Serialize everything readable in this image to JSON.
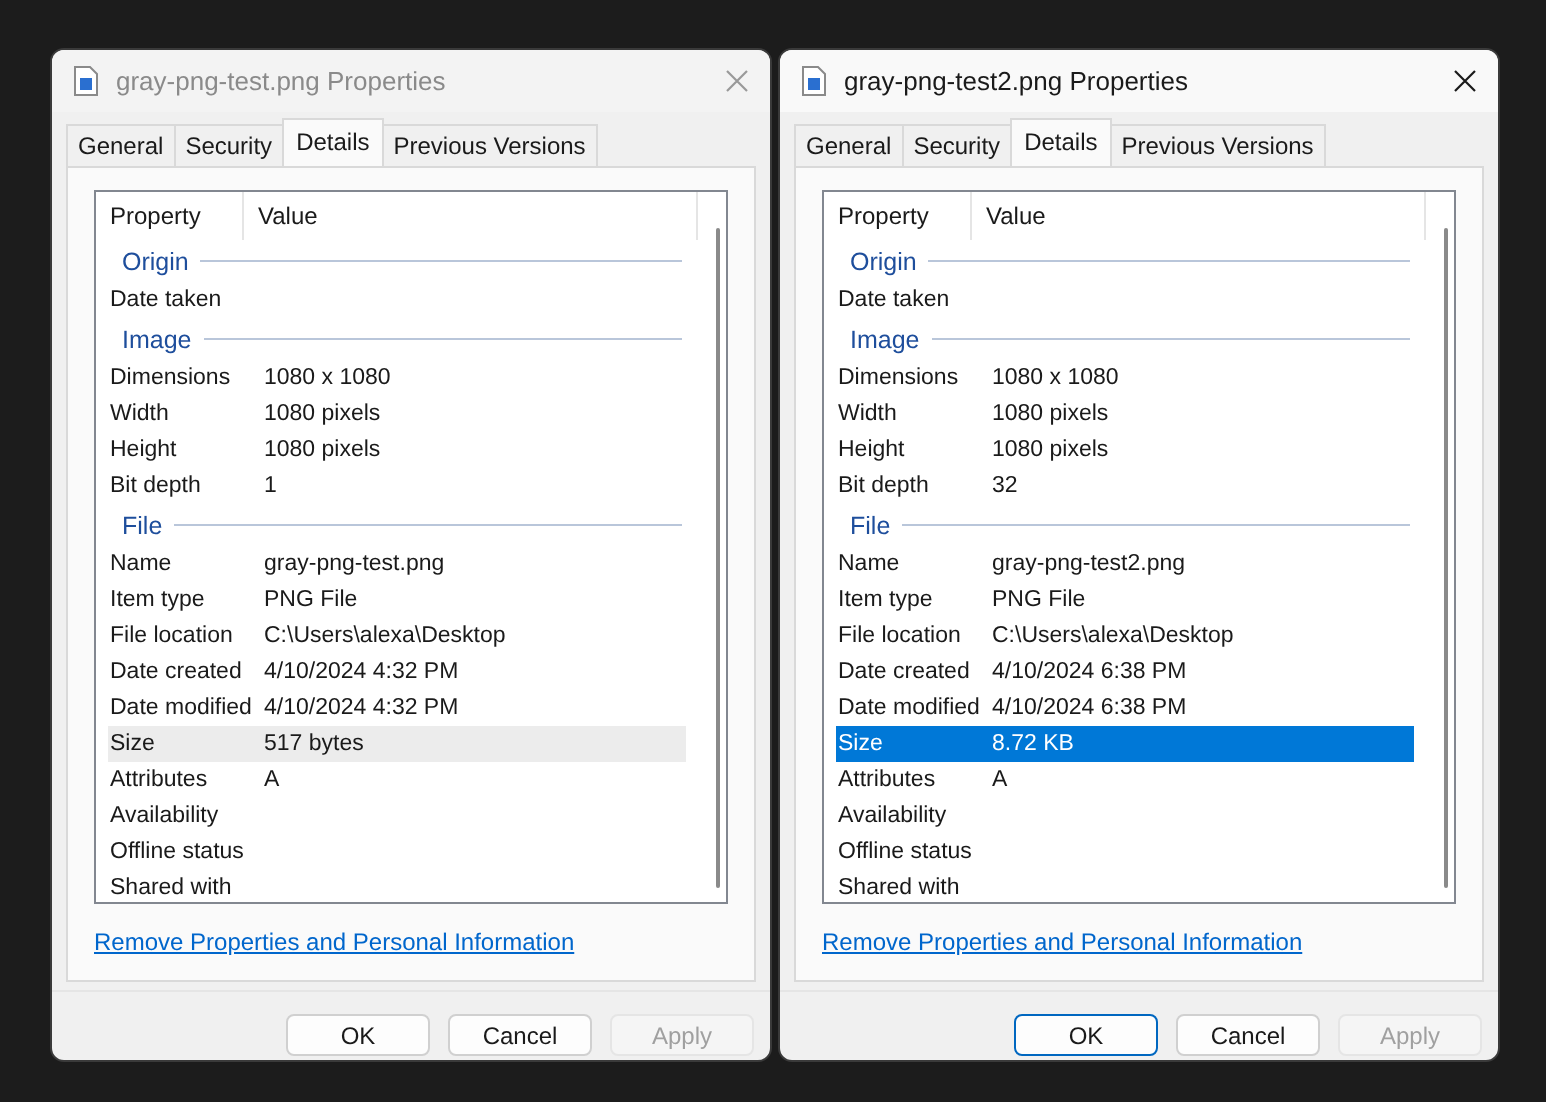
{
  "windows": [
    {
      "title": "gray-png-test.png Properties",
      "active": false,
      "tabs": [
        {
          "label": "General",
          "selected": false
        },
        {
          "label": "Security",
          "selected": false
        },
        {
          "label": "Details",
          "selected": true
        },
        {
          "label": "Previous Versions",
          "selected": false
        }
      ],
      "columns": [
        "Property",
        "Value"
      ],
      "rows": [
        {
          "kind": "section",
          "label": "Origin"
        },
        {
          "kind": "property",
          "name": "Date taken",
          "selected": false
        },
        {
          "kind": "section",
          "label": "Image"
        },
        {
          "kind": "property",
          "name": "Dimensions",
          "value": "1080 x 1080",
          "selected": false
        },
        {
          "kind": "property",
          "name": "Width",
          "value": "1080 pixels",
          "selected": false
        },
        {
          "kind": "property",
          "name": "Height",
          "value": "1080 pixels",
          "selected": false
        },
        {
          "kind": "property",
          "name": "Bit depth",
          "value": "1",
          "selected": false
        },
        {
          "kind": "section",
          "label": "File"
        },
        {
          "kind": "property",
          "name": "Name",
          "value": "gray-png-test.png",
          "selected": false
        },
        {
          "kind": "property",
          "name": "Item type",
          "value": "PNG File",
          "selected": false
        },
        {
          "kind": "property",
          "name": "File location",
          "value": "C:\\Users\\alexa\\Desktop",
          "selected": false
        },
        {
          "kind": "property",
          "name": "Date created",
          "value": "4/10/2024 4:32 PM",
          "selected": false
        },
        {
          "kind": "property",
          "name": "Date modified",
          "value": "4/10/2024 4:32 PM",
          "selected": false
        },
        {
          "kind": "property",
          "name": "Size",
          "value": "517 bytes",
          "selected": true
        },
        {
          "kind": "property",
          "name": "Attributes",
          "value": "A",
          "selected": false
        },
        {
          "kind": "property",
          "name": "Availability",
          "selected": false
        },
        {
          "kind": "property",
          "name": "Offline status",
          "selected": false
        },
        {
          "kind": "property",
          "name": "Shared with",
          "selected": false
        }
      ],
      "link": "Remove Properties and Personal Information",
      "buttons": [
        {
          "label": "OK",
          "default": false,
          "disabled": false
        },
        {
          "label": "Cancel",
          "default": false,
          "disabled": false
        },
        {
          "label": "Apply",
          "default": false,
          "disabled": true
        }
      ]
    },
    {
      "title": "gray-png-test2.png Properties",
      "active": true,
      "tabs": [
        {
          "label": "General",
          "selected": false
        },
        {
          "label": "Security",
          "selected": false
        },
        {
          "label": "Details",
          "selected": true
        },
        {
          "label": "Previous Versions",
          "selected": false
        }
      ],
      "columns": [
        "Property",
        "Value"
      ],
      "rows": [
        {
          "kind": "section",
          "label": "Origin"
        },
        {
          "kind": "property",
          "name": "Date taken",
          "selected": false
        },
        {
          "kind": "section",
          "label": "Image"
        },
        {
          "kind": "property",
          "name": "Dimensions",
          "value": "1080 x 1080",
          "selected": false
        },
        {
          "kind": "property",
          "name": "Width",
          "value": "1080 pixels",
          "selected": false
        },
        {
          "kind": "property",
          "name": "Height",
          "value": "1080 pixels",
          "selected": false
        },
        {
          "kind": "property",
          "name": "Bit depth",
          "value": "32",
          "selected": false
        },
        {
          "kind": "section",
          "label": "File"
        },
        {
          "kind": "property",
          "name": "Name",
          "value": "gray-png-test2.png",
          "selected": false
        },
        {
          "kind": "property",
          "name": "Item type",
          "value": "PNG File",
          "selected": false
        },
        {
          "kind": "property",
          "name": "File location",
          "value": "C:\\Users\\alexa\\Desktop",
          "selected": false
        },
        {
          "kind": "property",
          "name": "Date created",
          "value": "4/10/2024 6:38 PM",
          "selected": false
        },
        {
          "kind": "property",
          "name": "Date modified",
          "value": "4/10/2024 6:38 PM",
          "selected": false
        },
        {
          "kind": "property",
          "name": "Size",
          "value": "8.72 KB",
          "selected": true
        },
        {
          "kind": "property",
          "name": "Attributes",
          "value": "A",
          "selected": false
        },
        {
          "kind": "property",
          "name": "Availability",
          "selected": false
        },
        {
          "kind": "property",
          "name": "Offline status",
          "selected": false
        },
        {
          "kind": "property",
          "name": "Shared with",
          "selected": false
        }
      ],
      "link": "Remove Properties and Personal Information",
      "buttons": [
        {
          "label": "OK",
          "default": true,
          "disabled": false
        },
        {
          "label": "Cancel",
          "default": false,
          "disabled": false
        },
        {
          "label": "Apply",
          "default": false,
          "disabled": true
        }
      ]
    }
  ]
}
